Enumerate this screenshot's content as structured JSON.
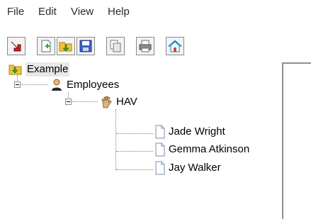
{
  "menu": {
    "items": [
      {
        "label": "File"
      },
      {
        "label": "Edit"
      },
      {
        "label": "View"
      },
      {
        "label": "Help"
      }
    ]
  },
  "toolbar": {
    "buttons": [
      {
        "icon": "exit-icon"
      },
      {
        "icon": "new-document-icon"
      },
      {
        "icon": "open-icon"
      },
      {
        "icon": "save-icon"
      },
      {
        "icon": "copy-icon"
      },
      {
        "icon": "print-icon"
      },
      {
        "icon": "home-icon"
      }
    ]
  },
  "tree": {
    "root": {
      "label": "Example",
      "icon": "folder-icon",
      "selected": true
    },
    "employees": {
      "label": "Employees",
      "icon": "person-icon",
      "expanded": true
    },
    "group": {
      "label": "HAV",
      "icon": "hand-icon",
      "expanded": true
    },
    "people": [
      {
        "label": "Jade Wright",
        "icon": "document-icon"
      },
      {
        "label": "Gemma Atkinson",
        "icon": "document-icon"
      },
      {
        "label": "Jay Walker",
        "icon": "document-icon"
      }
    ]
  },
  "colors": {
    "background": "#ffffff",
    "menu_text": "#2b2b2b",
    "tree_line": "#808080",
    "selection": "#e8e8e8"
  }
}
